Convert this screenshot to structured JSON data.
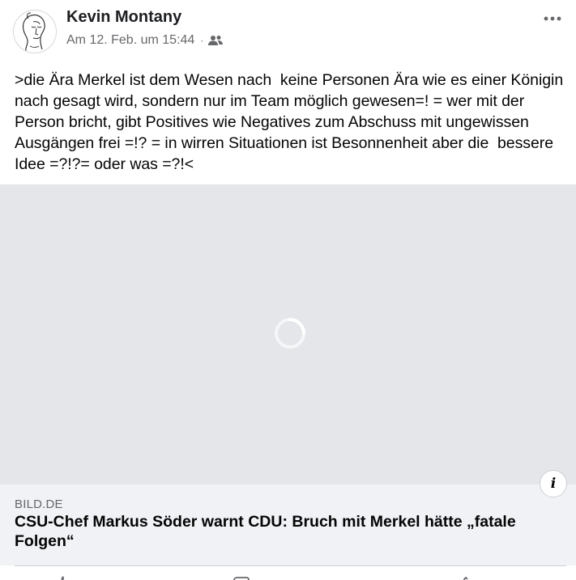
{
  "post": {
    "author": "Kevin Montany",
    "timestamp": "Am 12. Feb. um 15:44",
    "separator": "·",
    "audience_icon": "friends-icon",
    "more_icon": "more-dots-icon",
    "text": ">die Ära Merkel ist dem Wesen nach  keine Personen Ära wie es einer Königin nach gesagt wird, sondern nur im Team möglich gewesen=! = wer mit der Person bricht, gibt Positives wie Negatives zum Abschuss mit ungewissen Ausgängen frei =!? = in wirren Situationen ist Besonnenheit aber die  bessere Idee =?!?= oder was =?!<"
  },
  "link_preview": {
    "domain": "BILD.DE",
    "title": "CSU-Chef Markus Söder warnt CDU: Bruch mit Merkel hätte „fatale Folgen“",
    "info_label": "i",
    "media_state": "loading"
  },
  "colors": {
    "text_primary": "#050505",
    "text_secondary": "#65676b",
    "media_placeholder": "#e4e6e9",
    "card_background": "#f0f2f5"
  }
}
